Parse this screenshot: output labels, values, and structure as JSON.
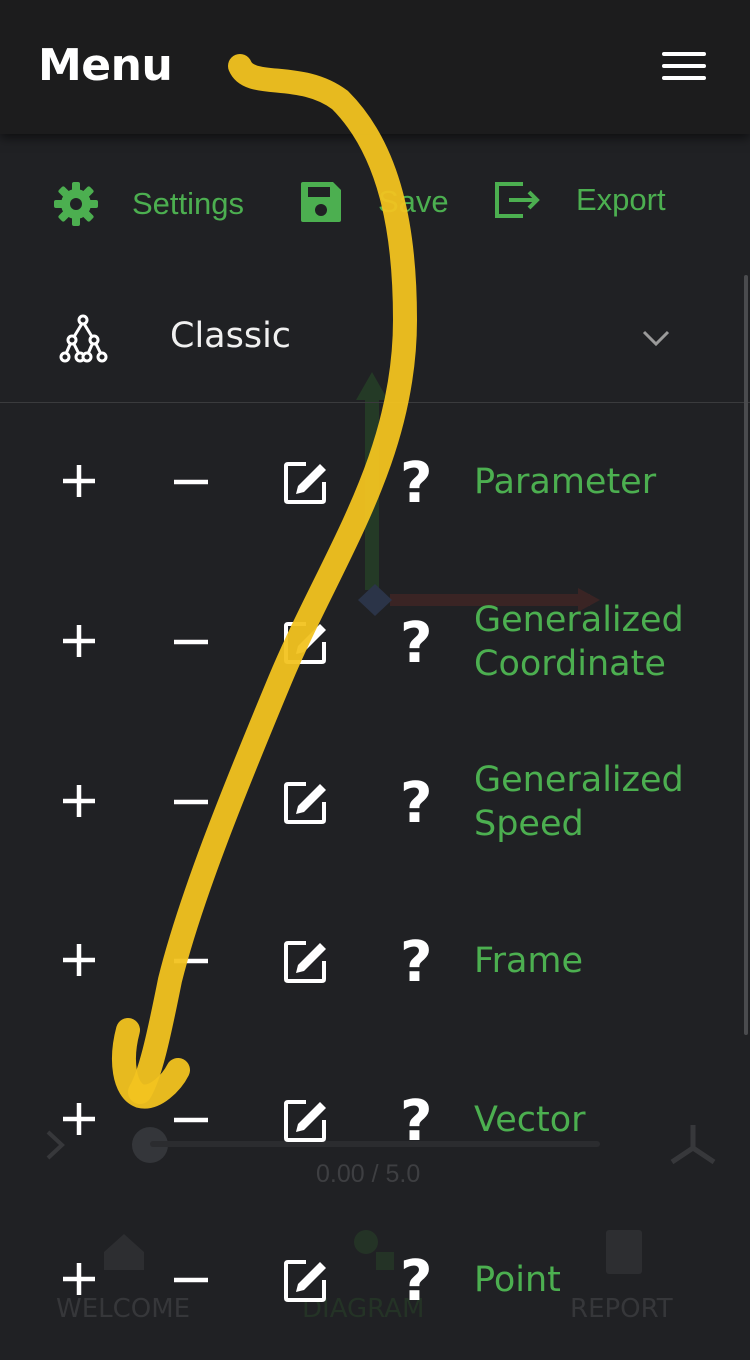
{
  "header": {
    "title": "Menu",
    "menu_icon": "hamburger-icon"
  },
  "toolbar": {
    "settings_label": "Settings",
    "save_label": "Save",
    "export_label": "Export"
  },
  "model": {
    "selected": "Classic",
    "icon": "tree-icon"
  },
  "items": [
    {
      "label": "Parameter"
    },
    {
      "label": "Generalized Coordinate"
    },
    {
      "label": "Generalized Speed"
    },
    {
      "label": "Frame"
    },
    {
      "label": "Vector"
    },
    {
      "label": "Point"
    }
  ],
  "background": {
    "time_readout": "0.00 / 5.0",
    "nav": {
      "welcome": "WELCOME",
      "diagram": "DIAGRAM",
      "report": "REPORT"
    }
  },
  "colors": {
    "accent": "#4caf50",
    "background": "#202124",
    "header": "#1c1c1d",
    "annotation": "#f2c320"
  }
}
